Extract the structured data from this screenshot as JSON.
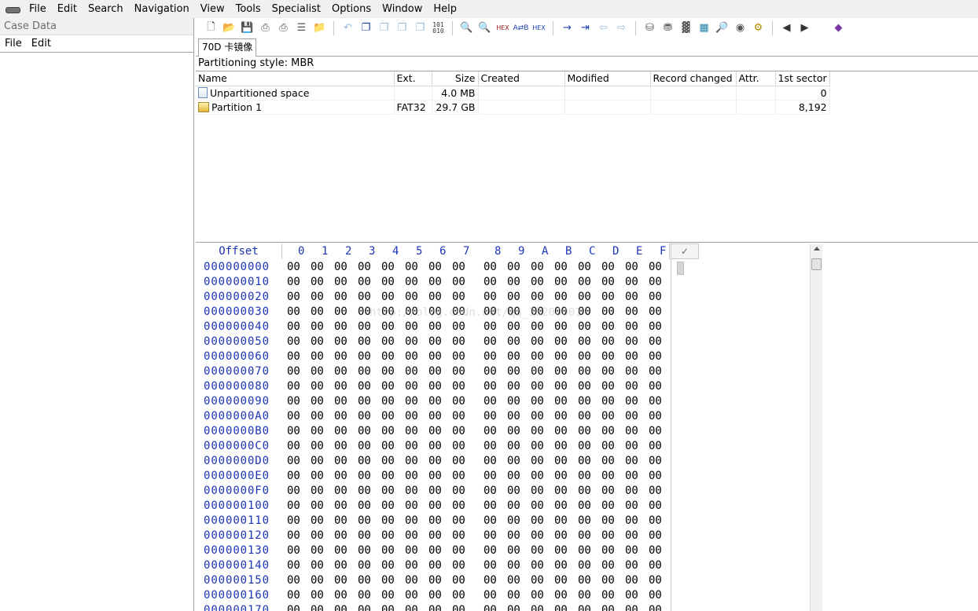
{
  "menubar": {
    "items": [
      "File",
      "Edit",
      "Search",
      "Navigation",
      "View",
      "Tools",
      "Specialist",
      "Options",
      "Window",
      "Help"
    ]
  },
  "left_panel": {
    "title": "Case Data",
    "menu": [
      "File",
      "Edit"
    ]
  },
  "toolbar": {
    "icons": [
      "new-file-icon",
      "open-file-icon",
      "save-icon",
      "print-icon",
      "printer-icon",
      "properties-icon",
      "open-folder-icon",
      "undo-icon",
      "copy-icon",
      "paste-icon",
      "paste-special-icon",
      "write-icon",
      "binary-icon",
      "find-text-icon",
      "find-hex-icon",
      "find-hex-red-icon",
      "replace-text-icon",
      "replace-hex-icon",
      "goto-offset-icon",
      "goto-sector-icon",
      "back-icon",
      "forward-icon",
      "open-disk-icon",
      "open-disks-icon",
      "open-ram-icon",
      "calculator-icon",
      "search-icon",
      "hash-icon",
      "settings-icon",
      "previous-icon",
      "next-icon",
      "help-book-icon"
    ]
  },
  "tabs": [
    {
      "label": "70D 卡镜像"
    }
  ],
  "partition_style": "Partitioning style: MBR",
  "directory": {
    "columns": [
      "Name",
      "Ext.",
      "Size",
      "Created",
      "Modified",
      "Record changed",
      "Attr.",
      "1st sector"
    ],
    "rows": [
      {
        "name": "Unpartitioned space",
        "ext": "",
        "size": "4.0 MB",
        "created": "",
        "modified": "",
        "record_changed": "",
        "attr": "",
        "first_sector": "0"
      },
      {
        "name": "Partition 1",
        "ext": "FAT32",
        "size": "29.7 GB",
        "created": "",
        "modified": "",
        "record_changed": "",
        "attr": "",
        "first_sector": "8,192"
      }
    ]
  },
  "hex": {
    "offset_label": "Offset",
    "columns": [
      "0",
      "1",
      "2",
      "3",
      "4",
      "5",
      "6",
      "7",
      "8",
      "9",
      "A",
      "B",
      "C",
      "D",
      "E",
      "F"
    ],
    "text_col_label": "✓",
    "offsets": [
      "000000000",
      "000000010",
      "000000020",
      "000000030",
      "000000040",
      "000000050",
      "000000060",
      "000000070",
      "000000080",
      "000000090",
      "0000000A0",
      "0000000B0",
      "0000000C0",
      "0000000D0",
      "0000000E0",
      "0000000F0",
      "000000100",
      "000000110",
      "000000120",
      "000000130",
      "000000140",
      "000000150",
      "000000160",
      "000000170"
    ],
    "byte_value": "00"
  },
  "watermark": "http://blog.csdn.net/qq_38200001"
}
